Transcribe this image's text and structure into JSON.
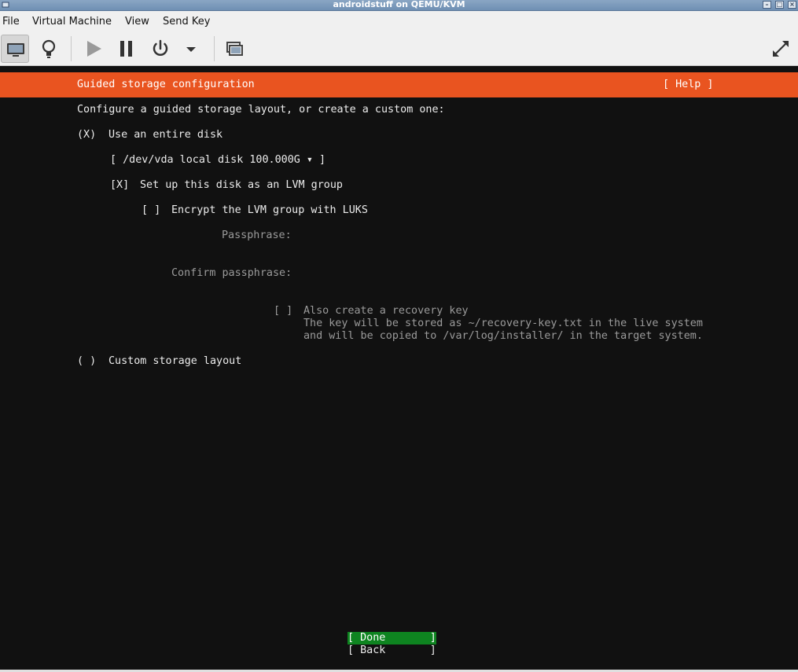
{
  "window": {
    "title": "androidstuff on QEMU/KVM"
  },
  "menubar": {
    "items": [
      "File",
      "Virtual Machine",
      "View",
      "Send Key"
    ]
  },
  "toolbar": {
    "icons": [
      "monitor-icon",
      "lightbulb-icon",
      "play-icon",
      "pause-icon",
      "power-icon",
      "chevron-down-icon",
      "screenshot-icon",
      "fullscreen-icon"
    ]
  },
  "installer": {
    "header_title": "Guided storage configuration",
    "help_label": "[ Help ]",
    "intro": "Configure a guided storage layout, or create a custom one:",
    "entire_disk_radio": "(X)",
    "entire_disk_label": "Use an entire disk",
    "disk_select": "[ /dev/vda local disk 100.000G ▾ ]",
    "lvm_checkbox": "[X]",
    "lvm_label": "Set up this disk as an LVM group",
    "luks_checkbox": "[ ]",
    "luks_label": "Encrypt the LVM group with LUKS",
    "passphrase_label": "Passphrase:",
    "confirm_passphrase_label": "Confirm passphrase:",
    "recovery_checkbox": "[ ]",
    "recovery_label": "Also create a recovery key",
    "recovery_desc_1": "The key will be stored as ~/recovery-key.txt in the live system",
    "recovery_desc_2": "and will be copied to /var/log/installer/ in the target system.",
    "custom_radio": "( )",
    "custom_label": "Custom storage layout",
    "done_button": "[ Done       ]",
    "back_button": "[ Back       ]"
  },
  "colors": {
    "header_orange": "#e95420",
    "done_green": "#0e8420",
    "console_bg": "#111111"
  }
}
